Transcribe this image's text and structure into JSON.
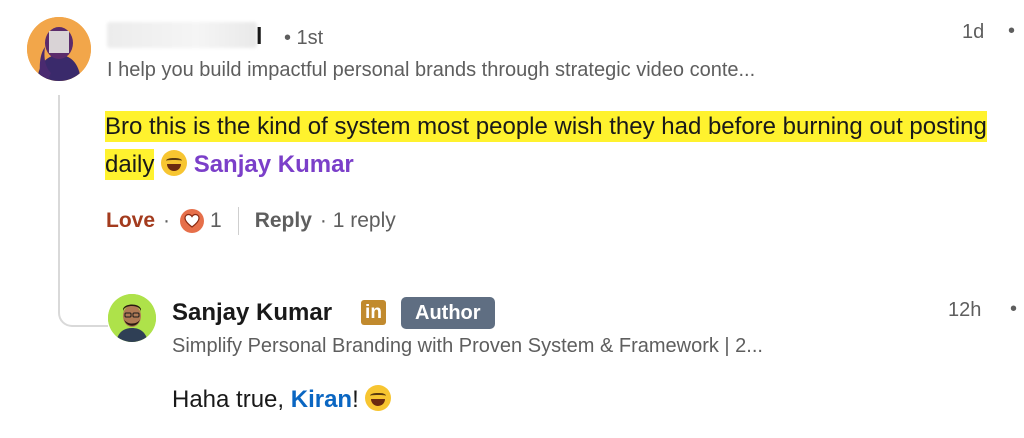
{
  "comment": {
    "author_name_visible": "l",
    "degree": "• 1st",
    "headline": "I help you build impactful personal brands through strategic video conte...",
    "timestamp": "1d",
    "more": "•",
    "text_part1": "Bro this is the kind of system most people wish they had before burning out posting daily",
    "mention": "Sanjay Kumar",
    "emoji": "grinning-sweat-emoji",
    "reaction_label": "Love",
    "reaction_sep": "·",
    "reaction_count": "1",
    "reply_label": "Reply",
    "replies_count": "· 1 reply"
  },
  "reply": {
    "author_name": "Sanjay Kumar",
    "in_badge": "in",
    "author_badge": "Author",
    "timestamp": "12h",
    "more": "•",
    "headline": "Simplify Personal Branding with Proven System & Framework | 2...",
    "text_prefix": "Haha true, ",
    "mention": "Kiran",
    "text_suffix": "!",
    "emoji": "grinning-sweat-emoji"
  },
  "colors": {
    "highlight": "#fff22e",
    "mention_purple": "#7b3fc9",
    "mention_blue": "#0a66c2",
    "love_red": "#a33b1e",
    "author_badge_bg": "#5f6e82"
  }
}
